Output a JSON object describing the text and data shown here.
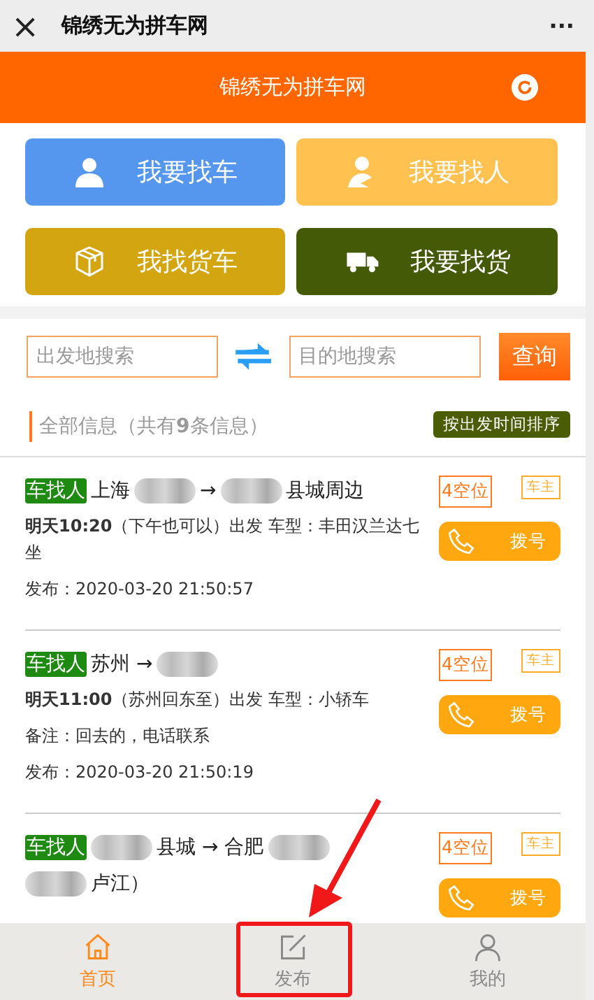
{
  "window": {
    "title": "锦绣无为拼车网",
    "close": "×",
    "more": "···"
  },
  "header": {
    "title": "锦绣无为拼车网"
  },
  "actions": [
    {
      "label": "我要找车",
      "kind": "person",
      "color": "#5597ee"
    },
    {
      "label": "我要找人",
      "kind": "driver",
      "color": "#ffc150"
    },
    {
      "label": "我找货车",
      "kind": "box",
      "color": "#d2a511"
    },
    {
      "label": "我要找货",
      "kind": "truck",
      "color": "#445a06"
    }
  ],
  "search": {
    "from_placeholder": "出发地搜索",
    "to_placeholder": "目的地搜索",
    "button": "查询"
  },
  "summary": {
    "text": "全部信息（共有**9**条信息）",
    "sort_button": "按出发时间排序"
  },
  "listings": [
    {
      "tag": "车找人",
      "route": [
        {
          "kind": "text",
          "text": "上海"
        },
        {
          "kind": "blur"
        },
        {
          "kind": "text",
          "text": "→"
        },
        {
          "kind": "blur"
        },
        {
          "kind": "text",
          "text": "县城周边"
        }
      ],
      "seats": "4空位",
      "role": "车主",
      "call": "拨号",
      "lines": [
        "**明天10:20**（下午也可以）出发 车型：丰田汉兰达七坐",
        "发布：2020-03-20 21:50:57"
      ]
    },
    {
      "tag": "车找人",
      "route": [
        {
          "kind": "text",
          "text": "苏州 →"
        },
        {
          "kind": "blur"
        }
      ],
      "seats": "4空位",
      "role": "车主",
      "call": "拨号",
      "lines": [
        "**明天11:00**（苏州回东至）出发 车型：小轿车",
        "备注：回去的，电话联系",
        "发布：2020-03-20 21:50:19"
      ]
    },
    {
      "tag": "车找人",
      "route": [
        {
          "kind": "blur"
        },
        {
          "kind": "text",
          "text": "县城 → 合肥"
        },
        {
          "kind": "blur"
        },
        {
          "kind": "break"
        },
        {
          "kind": "blur"
        },
        {
          "kind": "text",
          "text": "卢江）"
        }
      ],
      "seats": "4空位",
      "role": "车主",
      "call": "拨号"
    }
  ],
  "tabbar": [
    {
      "label": "首页",
      "kind": "home",
      "selected": true,
      "highlighted": false
    },
    {
      "label": "发布",
      "kind": "edit",
      "selected": false,
      "highlighted": true
    },
    {
      "label": "我的",
      "kind": "user",
      "selected": false,
      "highlighted": false
    }
  ]
}
